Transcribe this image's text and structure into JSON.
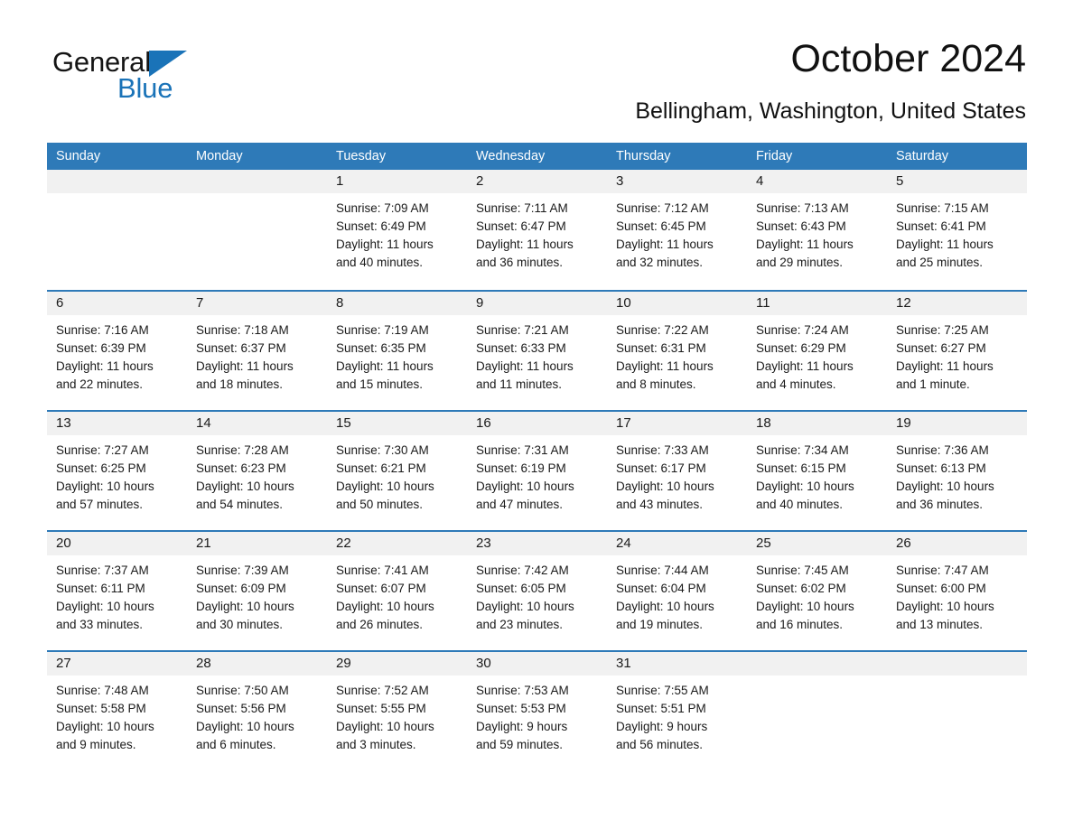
{
  "brand": {
    "name_top": "General",
    "name_bottom": "Blue",
    "triangle_icon": "triangle-icon",
    "accent_color": "#1a73b8"
  },
  "header": {
    "title": "October 2024",
    "subtitle": "Bellingham, Washington, United States"
  },
  "calendar": {
    "header_bg": "#2e7ab8",
    "day_band_bg": "#f1f1f1",
    "weekdays": [
      "Sunday",
      "Monday",
      "Tuesday",
      "Wednesday",
      "Thursday",
      "Friday",
      "Saturday"
    ],
    "weeks": [
      [
        {
          "day": "",
          "empty": true
        },
        {
          "day": "",
          "empty": true
        },
        {
          "day": "1",
          "sunrise": "Sunrise: 7:09 AM",
          "sunset": "Sunset: 6:49 PM",
          "daylight1": "Daylight: 11 hours",
          "daylight2": "and 40 minutes."
        },
        {
          "day": "2",
          "sunrise": "Sunrise: 7:11 AM",
          "sunset": "Sunset: 6:47 PM",
          "daylight1": "Daylight: 11 hours",
          "daylight2": "and 36 minutes."
        },
        {
          "day": "3",
          "sunrise": "Sunrise: 7:12 AM",
          "sunset": "Sunset: 6:45 PM",
          "daylight1": "Daylight: 11 hours",
          "daylight2": "and 32 minutes."
        },
        {
          "day": "4",
          "sunrise": "Sunrise: 7:13 AM",
          "sunset": "Sunset: 6:43 PM",
          "daylight1": "Daylight: 11 hours",
          "daylight2": "and 29 minutes."
        },
        {
          "day": "5",
          "sunrise": "Sunrise: 7:15 AM",
          "sunset": "Sunset: 6:41 PM",
          "daylight1": "Daylight: 11 hours",
          "daylight2": "and 25 minutes."
        }
      ],
      [
        {
          "day": "6",
          "sunrise": "Sunrise: 7:16 AM",
          "sunset": "Sunset: 6:39 PM",
          "daylight1": "Daylight: 11 hours",
          "daylight2": "and 22 minutes."
        },
        {
          "day": "7",
          "sunrise": "Sunrise: 7:18 AM",
          "sunset": "Sunset: 6:37 PM",
          "daylight1": "Daylight: 11 hours",
          "daylight2": "and 18 minutes."
        },
        {
          "day": "8",
          "sunrise": "Sunrise: 7:19 AM",
          "sunset": "Sunset: 6:35 PM",
          "daylight1": "Daylight: 11 hours",
          "daylight2": "and 15 minutes."
        },
        {
          "day": "9",
          "sunrise": "Sunrise: 7:21 AM",
          "sunset": "Sunset: 6:33 PM",
          "daylight1": "Daylight: 11 hours",
          "daylight2": "and 11 minutes."
        },
        {
          "day": "10",
          "sunrise": "Sunrise: 7:22 AM",
          "sunset": "Sunset: 6:31 PM",
          "daylight1": "Daylight: 11 hours",
          "daylight2": "and 8 minutes."
        },
        {
          "day": "11",
          "sunrise": "Sunrise: 7:24 AM",
          "sunset": "Sunset: 6:29 PM",
          "daylight1": "Daylight: 11 hours",
          "daylight2": "and 4 minutes."
        },
        {
          "day": "12",
          "sunrise": "Sunrise: 7:25 AM",
          "sunset": "Sunset: 6:27 PM",
          "daylight1": "Daylight: 11 hours",
          "daylight2": "and 1 minute."
        }
      ],
      [
        {
          "day": "13",
          "sunrise": "Sunrise: 7:27 AM",
          "sunset": "Sunset: 6:25 PM",
          "daylight1": "Daylight: 10 hours",
          "daylight2": "and 57 minutes."
        },
        {
          "day": "14",
          "sunrise": "Sunrise: 7:28 AM",
          "sunset": "Sunset: 6:23 PM",
          "daylight1": "Daylight: 10 hours",
          "daylight2": "and 54 minutes."
        },
        {
          "day": "15",
          "sunrise": "Sunrise: 7:30 AM",
          "sunset": "Sunset: 6:21 PM",
          "daylight1": "Daylight: 10 hours",
          "daylight2": "and 50 minutes."
        },
        {
          "day": "16",
          "sunrise": "Sunrise: 7:31 AM",
          "sunset": "Sunset: 6:19 PM",
          "daylight1": "Daylight: 10 hours",
          "daylight2": "and 47 minutes."
        },
        {
          "day": "17",
          "sunrise": "Sunrise: 7:33 AM",
          "sunset": "Sunset: 6:17 PM",
          "daylight1": "Daylight: 10 hours",
          "daylight2": "and 43 minutes."
        },
        {
          "day": "18",
          "sunrise": "Sunrise: 7:34 AM",
          "sunset": "Sunset: 6:15 PM",
          "daylight1": "Daylight: 10 hours",
          "daylight2": "and 40 minutes."
        },
        {
          "day": "19",
          "sunrise": "Sunrise: 7:36 AM",
          "sunset": "Sunset: 6:13 PM",
          "daylight1": "Daylight: 10 hours",
          "daylight2": "and 36 minutes."
        }
      ],
      [
        {
          "day": "20",
          "sunrise": "Sunrise: 7:37 AM",
          "sunset": "Sunset: 6:11 PM",
          "daylight1": "Daylight: 10 hours",
          "daylight2": "and 33 minutes."
        },
        {
          "day": "21",
          "sunrise": "Sunrise: 7:39 AM",
          "sunset": "Sunset: 6:09 PM",
          "daylight1": "Daylight: 10 hours",
          "daylight2": "and 30 minutes."
        },
        {
          "day": "22",
          "sunrise": "Sunrise: 7:41 AM",
          "sunset": "Sunset: 6:07 PM",
          "daylight1": "Daylight: 10 hours",
          "daylight2": "and 26 minutes."
        },
        {
          "day": "23",
          "sunrise": "Sunrise: 7:42 AM",
          "sunset": "Sunset: 6:05 PM",
          "daylight1": "Daylight: 10 hours",
          "daylight2": "and 23 minutes."
        },
        {
          "day": "24",
          "sunrise": "Sunrise: 7:44 AM",
          "sunset": "Sunset: 6:04 PM",
          "daylight1": "Daylight: 10 hours",
          "daylight2": "and 19 minutes."
        },
        {
          "day": "25",
          "sunrise": "Sunrise: 7:45 AM",
          "sunset": "Sunset: 6:02 PM",
          "daylight1": "Daylight: 10 hours",
          "daylight2": "and 16 minutes."
        },
        {
          "day": "26",
          "sunrise": "Sunrise: 7:47 AM",
          "sunset": "Sunset: 6:00 PM",
          "daylight1": "Daylight: 10 hours",
          "daylight2": "and 13 minutes."
        }
      ],
      [
        {
          "day": "27",
          "sunrise": "Sunrise: 7:48 AM",
          "sunset": "Sunset: 5:58 PM",
          "daylight1": "Daylight: 10 hours",
          "daylight2": "and 9 minutes."
        },
        {
          "day": "28",
          "sunrise": "Sunrise: 7:50 AM",
          "sunset": "Sunset: 5:56 PM",
          "daylight1": "Daylight: 10 hours",
          "daylight2": "and 6 minutes."
        },
        {
          "day": "29",
          "sunrise": "Sunrise: 7:52 AM",
          "sunset": "Sunset: 5:55 PM",
          "daylight1": "Daylight: 10 hours",
          "daylight2": "and 3 minutes."
        },
        {
          "day": "30",
          "sunrise": "Sunrise: 7:53 AM",
          "sunset": "Sunset: 5:53 PM",
          "daylight1": "Daylight: 9 hours",
          "daylight2": "and 59 minutes."
        },
        {
          "day": "31",
          "sunrise": "Sunrise: 7:55 AM",
          "sunset": "Sunset: 5:51 PM",
          "daylight1": "Daylight: 9 hours",
          "daylight2": "and 56 minutes."
        },
        {
          "day": "",
          "empty": true
        },
        {
          "day": "",
          "empty": true
        }
      ]
    ]
  }
}
